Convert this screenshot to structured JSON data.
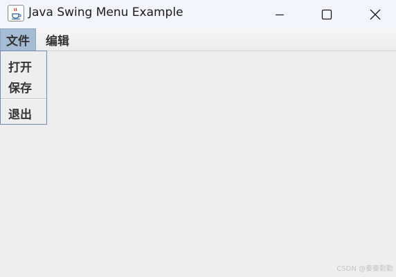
{
  "window": {
    "title": "Java Swing Menu Example",
    "icon": "java-coffee-icon"
  },
  "titlebar_controls": {
    "minimize_icon": "minimize-icon",
    "maximize_icon": "maximize-icon",
    "close_icon": "close-icon"
  },
  "menubar": {
    "menus": [
      {
        "label": "文件",
        "open": true
      },
      {
        "label": "编辑",
        "open": false
      }
    ]
  },
  "file_menu": {
    "items": [
      {
        "label": "打开"
      },
      {
        "label": "保存"
      },
      {
        "separator": true
      },
      {
        "label": "退出"
      }
    ]
  },
  "watermark": "CSDN @秦秦勤勤",
  "colors": {
    "titlebar_bg": "#f2f5fb",
    "content_bg": "#eeeeee",
    "menu_selected_bg": "#a5bcd4",
    "popup_border": "#6f89b0"
  }
}
